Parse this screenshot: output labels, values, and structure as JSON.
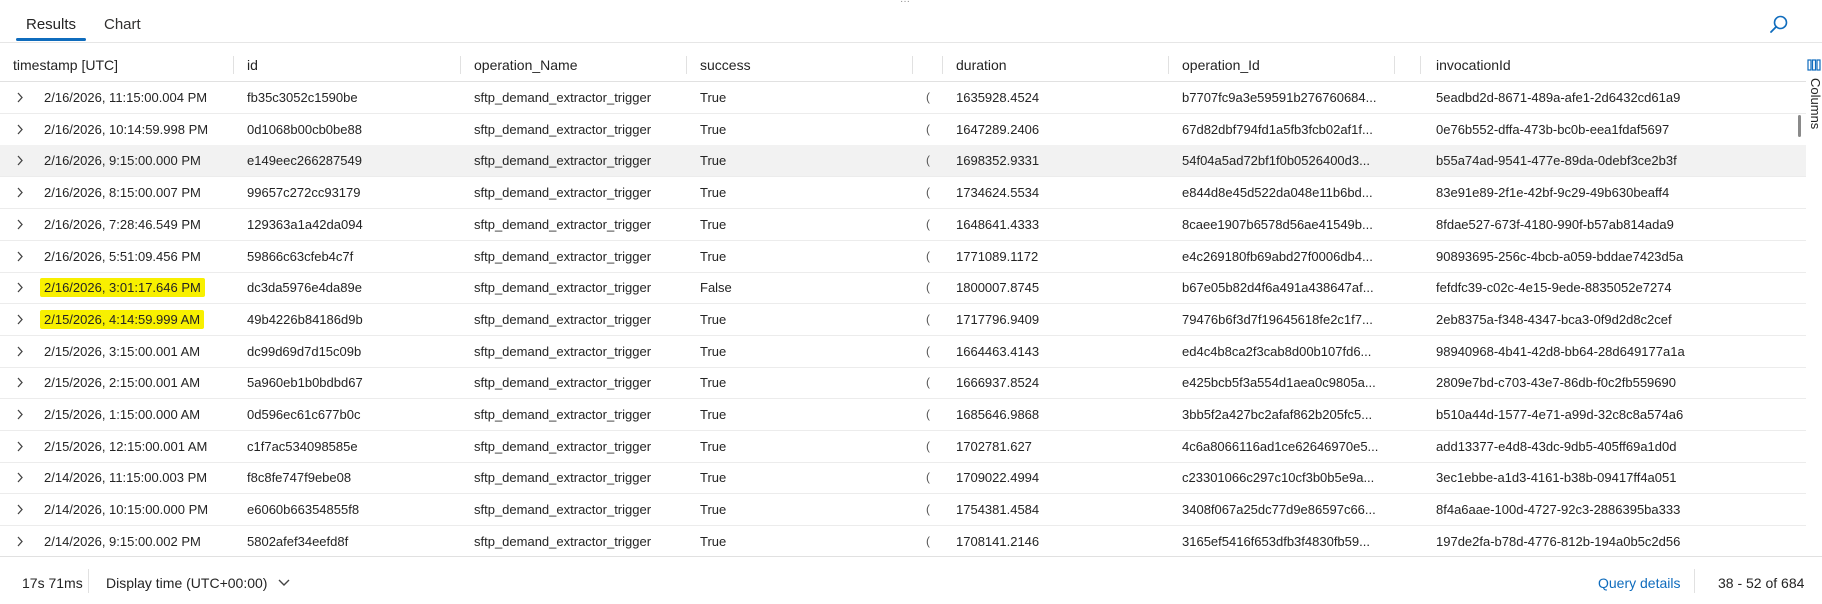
{
  "tabs": {
    "results": "Results",
    "chart": "Chart"
  },
  "columns": {
    "timestamp": "timestamp [UTC]",
    "id": "id",
    "operation_name": "operation_Name",
    "success": "success",
    "duration": "duration",
    "operation_id": "operation_Id",
    "invocation_id": "invocationId"
  },
  "side_panel": {
    "columns_label": "Columns"
  },
  "rows": [
    {
      "ts": "2/16/2026, 11:15:00.004 PM",
      "id": "fb35c3052c1590be",
      "op": "sftp_demand_extractor_trigger",
      "success": "True",
      "duration": "1635928.4524",
      "opid": "b7707fc9a3e59591b276760684...",
      "inv": "5eadbd2d-8671-489a-afe1-2d6432cd61a9"
    },
    {
      "ts": "2/16/2026, 10:14:59.998 PM",
      "id": "0d1068b00cb0be88",
      "op": "sftp_demand_extractor_trigger",
      "success": "True",
      "duration": "1647289.2406",
      "opid": "67d82dbf794fd1a5fb3fcb02af1f...",
      "inv": "0e76b552-dffa-473b-bc0b-eea1fdaf5697"
    },
    {
      "ts": "2/16/2026, 9:15:00.000 PM",
      "id": "e149eec266287549",
      "op": "sftp_demand_extractor_trigger",
      "success": "True",
      "duration": "1698352.9331",
      "opid": "54f04a5ad72bf1f0b0526400d3...",
      "inv": "b55a74ad-9541-477e-89da-0debf3ce2b3f"
    },
    {
      "ts": "2/16/2026, 8:15:00.007 PM",
      "id": "99657c272cc93179",
      "op": "sftp_demand_extractor_trigger",
      "success": "True",
      "duration": "1734624.5534",
      "opid": "e844d8e45d522da048e11b6bd...",
      "inv": "83e91e89-2f1e-42bf-9c29-49b630beaff4"
    },
    {
      "ts": "2/16/2026, 7:28:46.549 PM",
      "id": "129363a1a42da094",
      "op": "sftp_demand_extractor_trigger",
      "success": "True",
      "duration": "1648641.4333",
      "opid": "8caee1907b6578d56ae41549b...",
      "inv": "8fdae527-673f-4180-990f-b57ab814ada9"
    },
    {
      "ts": "2/16/2026, 5:51:09.456 PM",
      "id": "59866c63cfeb4c7f",
      "op": "sftp_demand_extractor_trigger",
      "success": "True",
      "duration": "1771089.1172",
      "opid": "e4c269180fb69abd27f0006db4...",
      "inv": "90893695-256c-4bcb-a059-bddae7423d5a"
    },
    {
      "ts": "2/16/2026, 3:01:17.646 PM",
      "id": "dc3da5976e4da89e",
      "op": "sftp_demand_extractor_trigger",
      "success": "False",
      "duration": "1800007.8745",
      "opid": "b67e05b82d4f6a491a438647af...",
      "inv": "fefdfc39-c02c-4e15-9ede-8835052e7274"
    },
    {
      "ts": "2/15/2026, 4:14:59.999 AM",
      "id": "49b4226b84186d9b",
      "op": "sftp_demand_extractor_trigger",
      "success": "True",
      "duration": "1717796.9409",
      "opid": "79476b6f3d7f19645618fe2c1f7...",
      "inv": "2eb8375a-f348-4347-bca3-0f9d2d8c2cef"
    },
    {
      "ts": "2/15/2026, 3:15:00.001 AM",
      "id": "dc99d69d7d15c09b",
      "op": "sftp_demand_extractor_trigger",
      "success": "True",
      "duration": "1664463.4143",
      "opid": "ed4c4b8ca2f3cab8d00b107fd6...",
      "inv": "98940968-4b41-42d8-bb64-28d649177a1a"
    },
    {
      "ts": "2/15/2026, 2:15:00.001 AM",
      "id": "5a960eb1b0bdbd67",
      "op": "sftp_demand_extractor_trigger",
      "success": "True",
      "duration": "1666937.8524",
      "opid": "e425bcb5f3a554d1aea0c9805a...",
      "inv": "2809e7bd-c703-43e7-86db-f0c2fb559690"
    },
    {
      "ts": "2/15/2026, 1:15:00.000 AM",
      "id": "0d596ec61c677b0c",
      "op": "sftp_demand_extractor_trigger",
      "success": "True",
      "duration": "1685646.9868",
      "opid": "3bb5f2a427bc2afaf862b205fc5...",
      "inv": "b510a44d-1577-4e71-a99d-32c8c8a574a6"
    },
    {
      "ts": "2/15/2026, 12:15:00.001 AM",
      "id": "c1f7ac534098585e",
      "op": "sftp_demand_extractor_trigger",
      "success": "True",
      "duration": "1702781.627",
      "opid": "4c6a8066116ad1ce62646970e5...",
      "inv": "add13377-e4d8-43dc-9db5-405ff69a1d0d"
    },
    {
      "ts": "2/14/2026, 11:15:00.003 PM",
      "id": "f8c8fe747f9ebe08",
      "op": "sftp_demand_extractor_trigger",
      "success": "True",
      "duration": "1709022.4994",
      "opid": "c23301066c297c10cf3b0b5e9a...",
      "inv": "3ec1ebbe-a1d3-4161-b38b-09417ff4a051"
    },
    {
      "ts": "2/14/2026, 10:15:00.000 PM",
      "id": "e6060b66354855f8",
      "op": "sftp_demand_extractor_trigger",
      "success": "True",
      "duration": "1754381.4584",
      "opid": "3408f067a25dc77d9e86597c66...",
      "inv": "8f4a6aae-100d-4727-92c3-2886395ba333"
    },
    {
      "ts": "2/14/2026, 9:15:00.002 PM",
      "id": "5802afef34eefd8f",
      "op": "sftp_demand_extractor_trigger",
      "success": "True",
      "duration": "1708141.2146",
      "opid": "3165ef5416f653dfb3f4830fb59...",
      "inv": "197de2fa-b78d-4776-812b-194a0b5c2d56"
    }
  ],
  "footer": {
    "elapsed": "17s 71ms",
    "display_time": "Display time (UTC+00:00)",
    "query_details": "Query details",
    "range": "38 - 52 of 684"
  },
  "colors": {
    "accent": "#0f6cbd",
    "highlight": "#f8f000",
    "selected_row": "#f2f2f2"
  }
}
